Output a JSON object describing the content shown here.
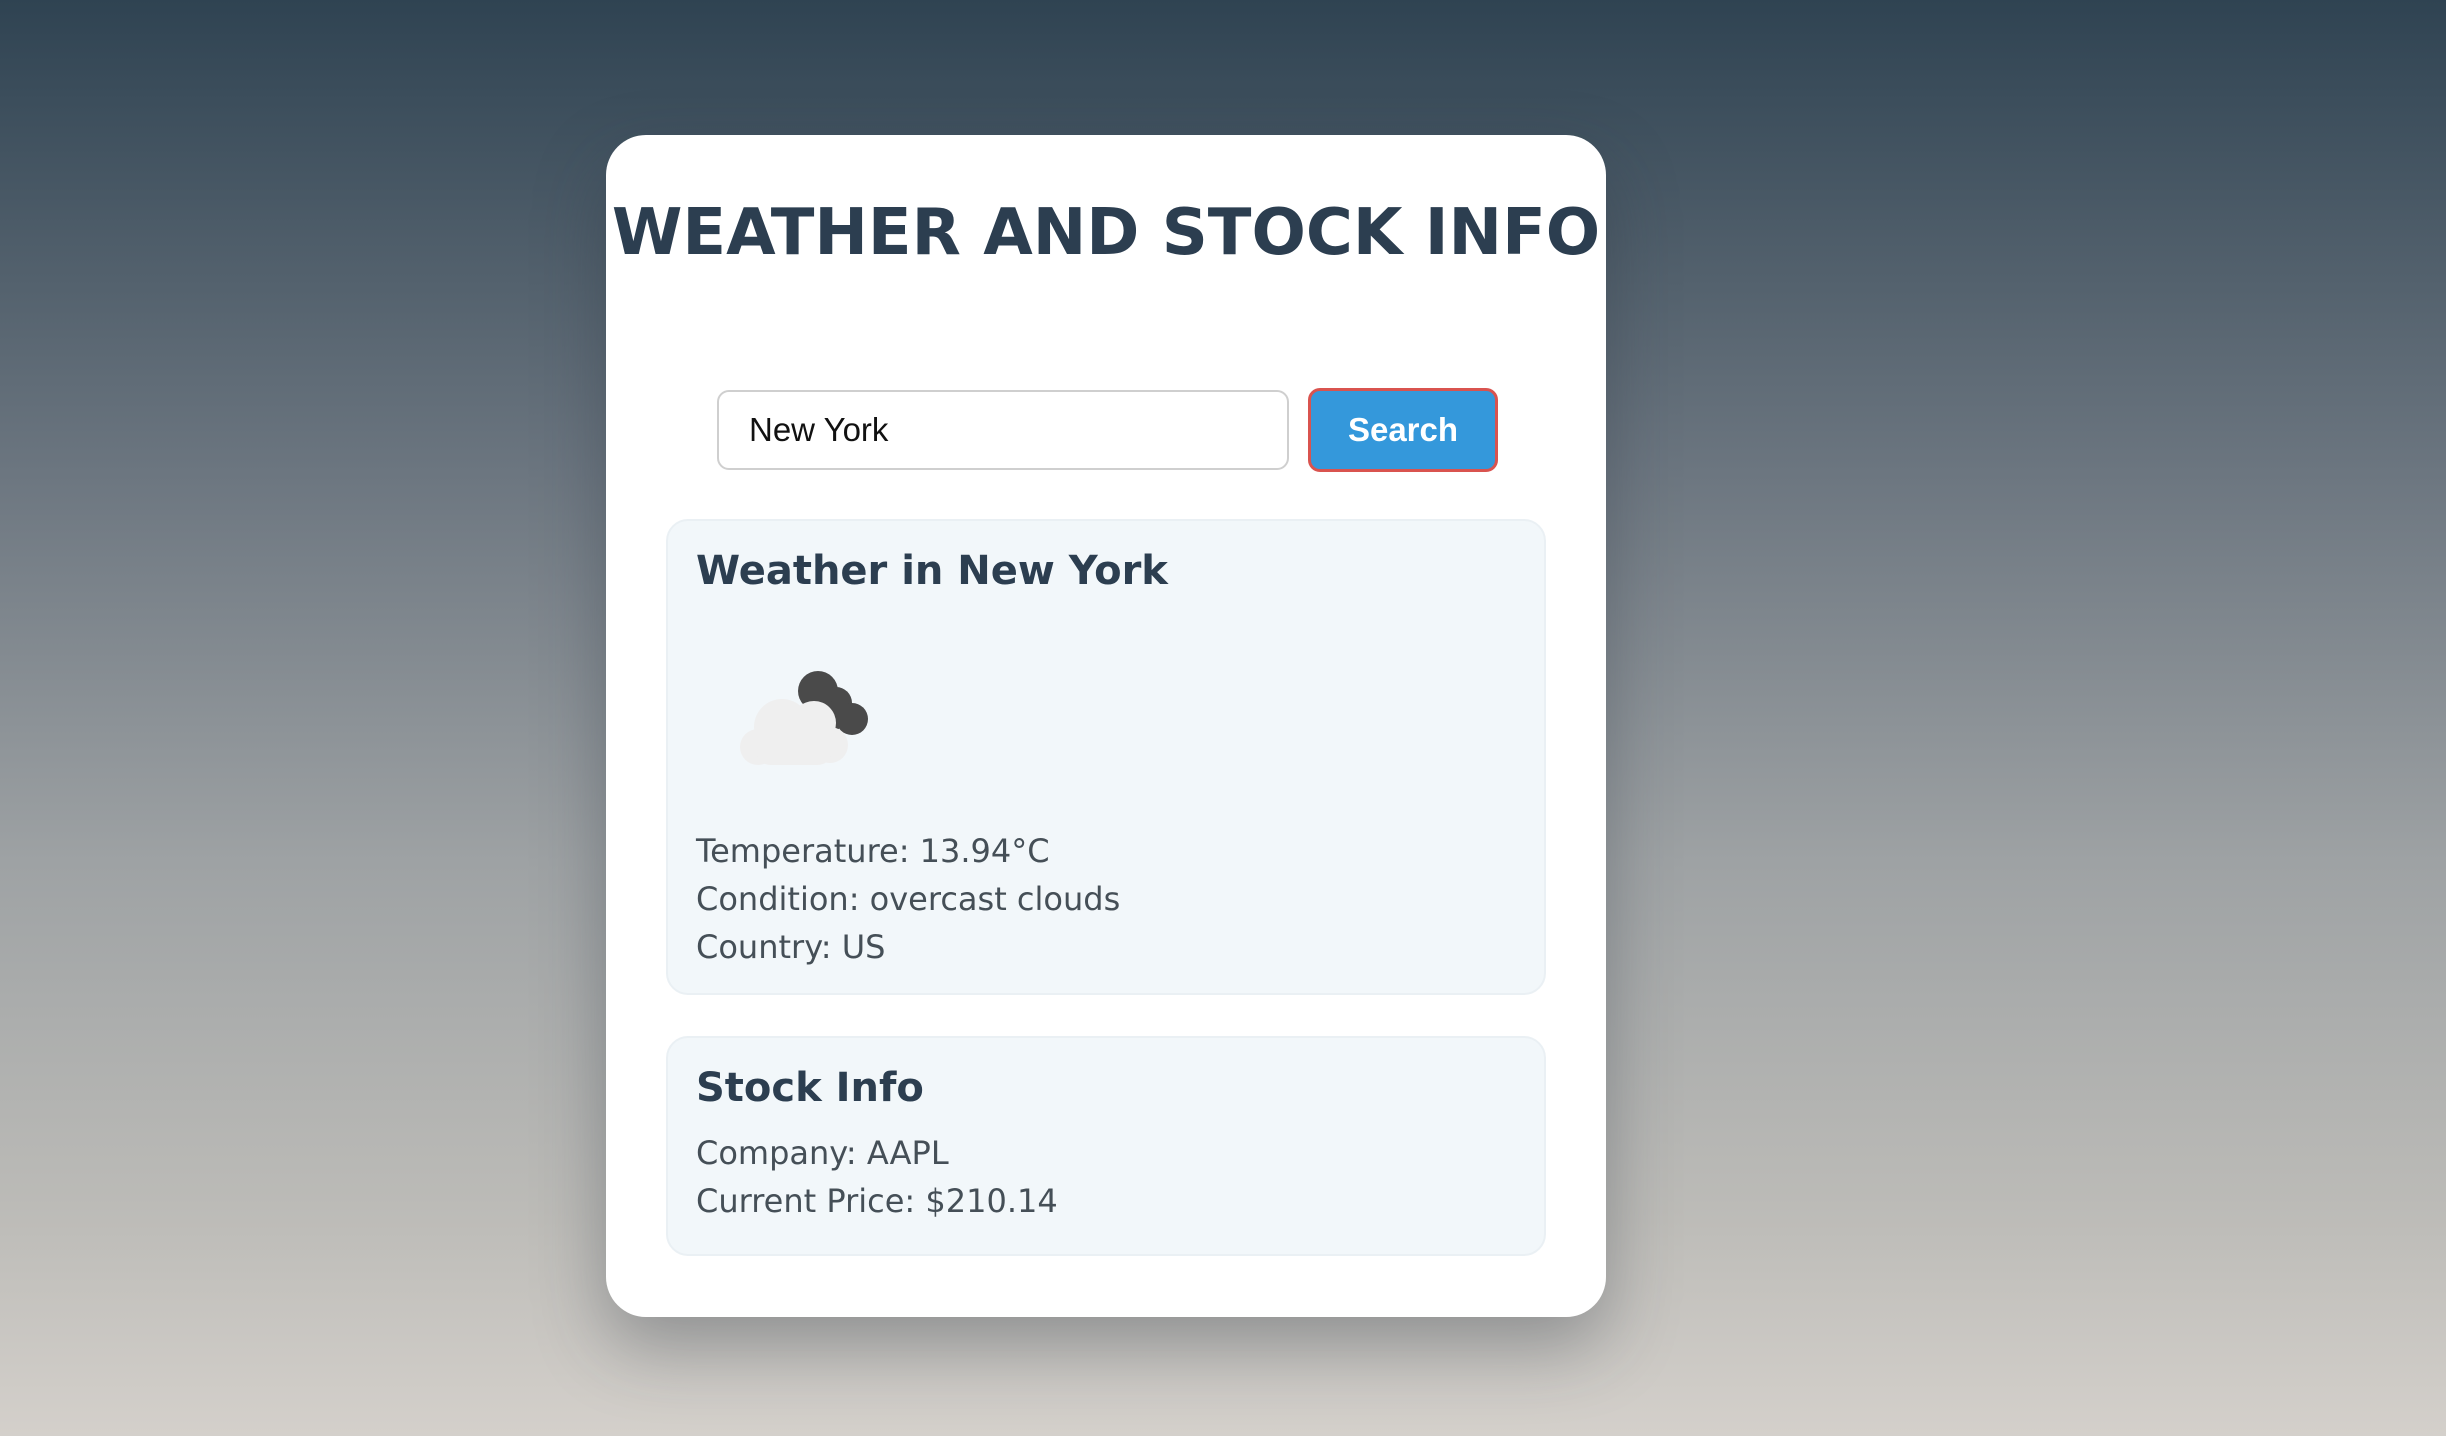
{
  "app": {
    "title": "WEATHER AND STOCK INFO"
  },
  "search": {
    "value": "New York",
    "button_label": "Search"
  },
  "weather": {
    "heading": "Weather in New York",
    "icon": "overcast-clouds-icon",
    "temperature": "Temperature: 13.94°C",
    "condition": "Condition: overcast clouds",
    "country": "Country: US"
  },
  "stock": {
    "heading": "Stock Info",
    "company": "Company: AAPL",
    "price": "Current Price: $210.14"
  },
  "colors": {
    "accent": "#3498db",
    "heading": "#2c3e50",
    "button_border": "#d9534f",
    "panel_bg": "#f2f7fa"
  }
}
